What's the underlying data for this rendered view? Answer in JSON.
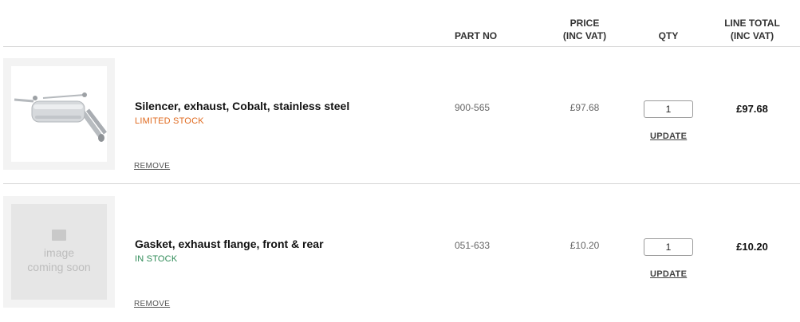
{
  "header": {
    "part_no": "PART NO",
    "price_line1": "PRICE",
    "price_line2": "(INC VAT)",
    "qty": "QTY",
    "total_line1": "LINE TOTAL",
    "total_line2": "(INC VAT)"
  },
  "items": [
    {
      "name": "Silencer, exhaust, Cobalt, stainless steel",
      "stock": "LIMITED STOCK",
      "part_no": "900-565",
      "price": "£97.68",
      "qty": "1",
      "update": "UPDATE",
      "total": "£97.68",
      "remove": "REMOVE",
      "stock_color": "#e06a1f"
    },
    {
      "name": "Gasket, exhaust flange, front & rear",
      "stock": "IN STOCK",
      "part_no": "051-633",
      "price": "£10.20",
      "qty": "1",
      "update": "UPDATE",
      "total": "£10.20",
      "remove": "REMOVE",
      "placeholder_line1": "image",
      "placeholder_line2": "coming soon",
      "stock_color": "#2e8b57"
    }
  ]
}
